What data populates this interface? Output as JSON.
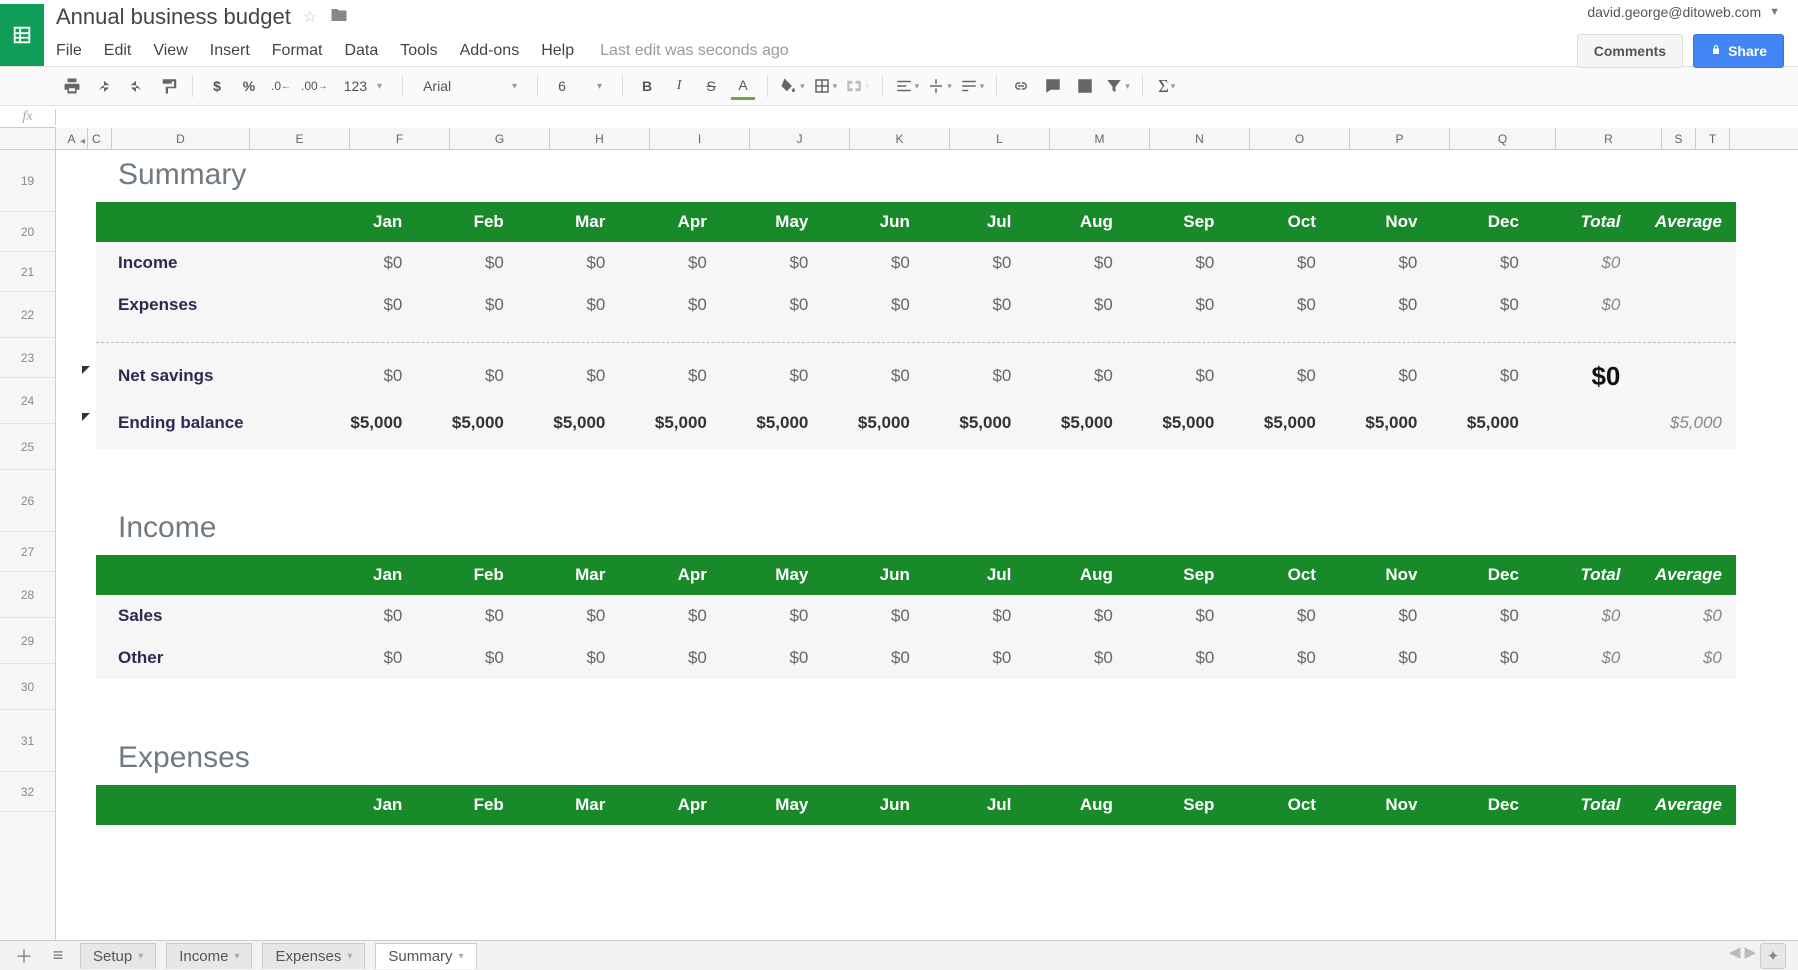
{
  "header": {
    "doc_title": "Annual business budget",
    "account_email": "david.george@ditoweb.com",
    "comments_label": "Comments",
    "share_label": "Share"
  },
  "menus": {
    "file": "File",
    "edit": "Edit",
    "view": "View",
    "insert": "Insert",
    "format": "Format",
    "data": "Data",
    "tools": "Tools",
    "addons": "Add-ons",
    "help": "Help",
    "last_edit": "Last edit was seconds ago"
  },
  "toolbar": {
    "font_family": "Arial",
    "font_size": "6",
    "num_fmt": "123"
  },
  "columns_visible": {
    "a": "A",
    "c": "C",
    "d": "D",
    "e": "E",
    "f": "F",
    "g": "G",
    "h": "H",
    "i": "I",
    "j": "J",
    "k": "K",
    "l": "L",
    "m": "M",
    "n": "N",
    "o": "O",
    "p": "P",
    "q": "Q",
    "r": "R",
    "s": "S",
    "t": "T"
  },
  "row_numbers": {
    "r1": "19",
    "r2": "20",
    "r3": "21",
    "r4": "22",
    "r5": "23",
    "r6": "24",
    "r7": "25",
    "r8": "26",
    "r9": "27",
    "r10": "28",
    "r11": "29",
    "r12": "30",
    "r13": "31",
    "r14": "32"
  },
  "months_hdr": {
    "m1": "Jan",
    "m2": "Feb",
    "m3": "Mar",
    "m4": "Apr",
    "m5": "May",
    "m6": "Jun",
    "m7": "Jul",
    "m8": "Aug",
    "m9": "Sep",
    "m10": "Oct",
    "m11": "Nov",
    "m12": "Dec",
    "total": "Total",
    "avg": "Average"
  },
  "sections": {
    "summary_title": "Summary",
    "income_title": "Income",
    "expenses_title": "Expenses"
  },
  "summary": {
    "income_lbl": "Income",
    "expenses_lbl": "Expenses",
    "net_lbl": "Net savings",
    "ending_lbl": "Ending balance",
    "income": {
      "m1": "$0",
      "m2": "$0",
      "m3": "$0",
      "m4": "$0",
      "m5": "$0",
      "m6": "$0",
      "m7": "$0",
      "m8": "$0",
      "m9": "$0",
      "m10": "$0",
      "m11": "$0",
      "m12": "$0",
      "total": "$0",
      "avg": ""
    },
    "expenses": {
      "m1": "$0",
      "m2": "$0",
      "m3": "$0",
      "m4": "$0",
      "m5": "$0",
      "m6": "$0",
      "m7": "$0",
      "m8": "$0",
      "m9": "$0",
      "m10": "$0",
      "m11": "$0",
      "m12": "$0",
      "total": "$0",
      "avg": ""
    },
    "net": {
      "m1": "$0",
      "m2": "$0",
      "m3": "$0",
      "m4": "$0",
      "m5": "$0",
      "m6": "$0",
      "m7": "$0",
      "m8": "$0",
      "m9": "$0",
      "m10": "$0",
      "m11": "$0",
      "m12": "$0",
      "total": "$0",
      "avg": ""
    },
    "ending": {
      "m1": "$5,000",
      "m2": "$5,000",
      "m3": "$5,000",
      "m4": "$5,000",
      "m5": "$5,000",
      "m6": "$5,000",
      "m7": "$5,000",
      "m8": "$5,000",
      "m9": "$5,000",
      "m10": "$5,000",
      "m11": "$5,000",
      "m12": "$5,000",
      "total": "",
      "avg": "$5,000"
    }
  },
  "income_sec": {
    "sales_lbl": "Sales",
    "other_lbl": "Other",
    "sales": {
      "m1": "$0",
      "m2": "$0",
      "m3": "$0",
      "m4": "$0",
      "m5": "$0",
      "m6": "$0",
      "m7": "$0",
      "m8": "$0",
      "m9": "$0",
      "m10": "$0",
      "m11": "$0",
      "m12": "$0",
      "total": "$0",
      "avg": "$0"
    },
    "other": {
      "m1": "$0",
      "m2": "$0",
      "m3": "$0",
      "m4": "$0",
      "m5": "$0",
      "m6": "$0",
      "m7": "$0",
      "m8": "$0",
      "m9": "$0",
      "m10": "$0",
      "m11": "$0",
      "m12": "$0",
      "total": "$0",
      "avg": "$0"
    }
  },
  "tabs": {
    "setup": "Setup",
    "income": "Income",
    "expenses": "Expenses",
    "summary": "Summary"
  }
}
